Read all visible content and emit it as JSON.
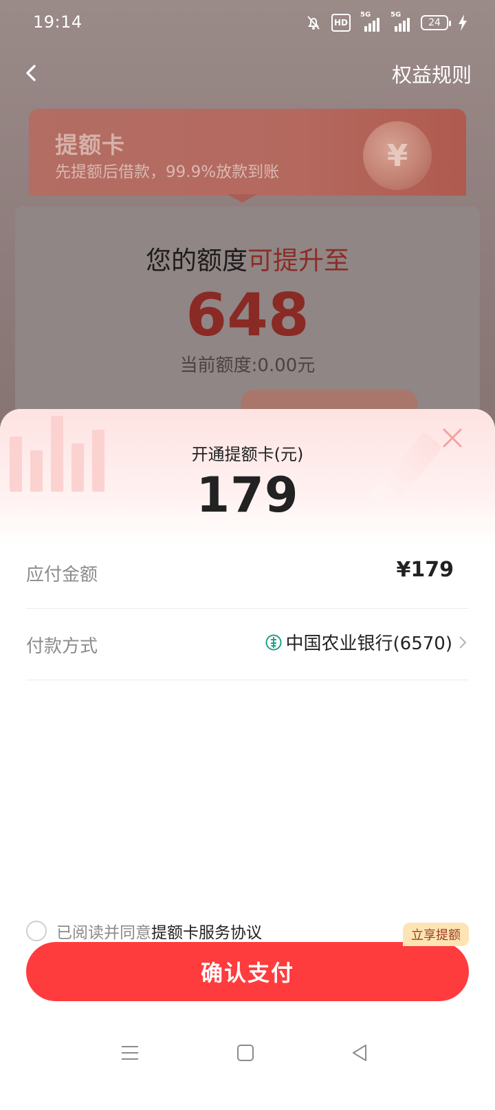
{
  "status_bar": {
    "time": "19:14",
    "hd_label": "HD",
    "network_1": "5G",
    "network_2": "5G",
    "battery": "24"
  },
  "topbar": {
    "rules_label": "权益规则"
  },
  "banner": {
    "title": "提额卡",
    "subtitle": "先提额后借款，99.9%放款到账",
    "coin_symbol": "¥"
  },
  "quota": {
    "title_prefix": "您的额度",
    "title_highlight": "可提升至",
    "amount": "648",
    "current": "当前额度:0.00元"
  },
  "sheet": {
    "title": "开通提额卡(元)",
    "amount": "179",
    "rows": {
      "payable_label": "应付金额",
      "payable_value": "¥179",
      "method_label": "付款方式",
      "method_value": "中国农业银行(6570)"
    },
    "agreement_prefix": "已阅读并同意",
    "agreement_link": "提额卡服务协议",
    "badge": "立享提额",
    "confirm_label": "确认支付"
  },
  "colors": {
    "accent": "#fe3c3e",
    "badge_bg": "#fde4b4",
    "bank_green": "#1aa28a"
  }
}
